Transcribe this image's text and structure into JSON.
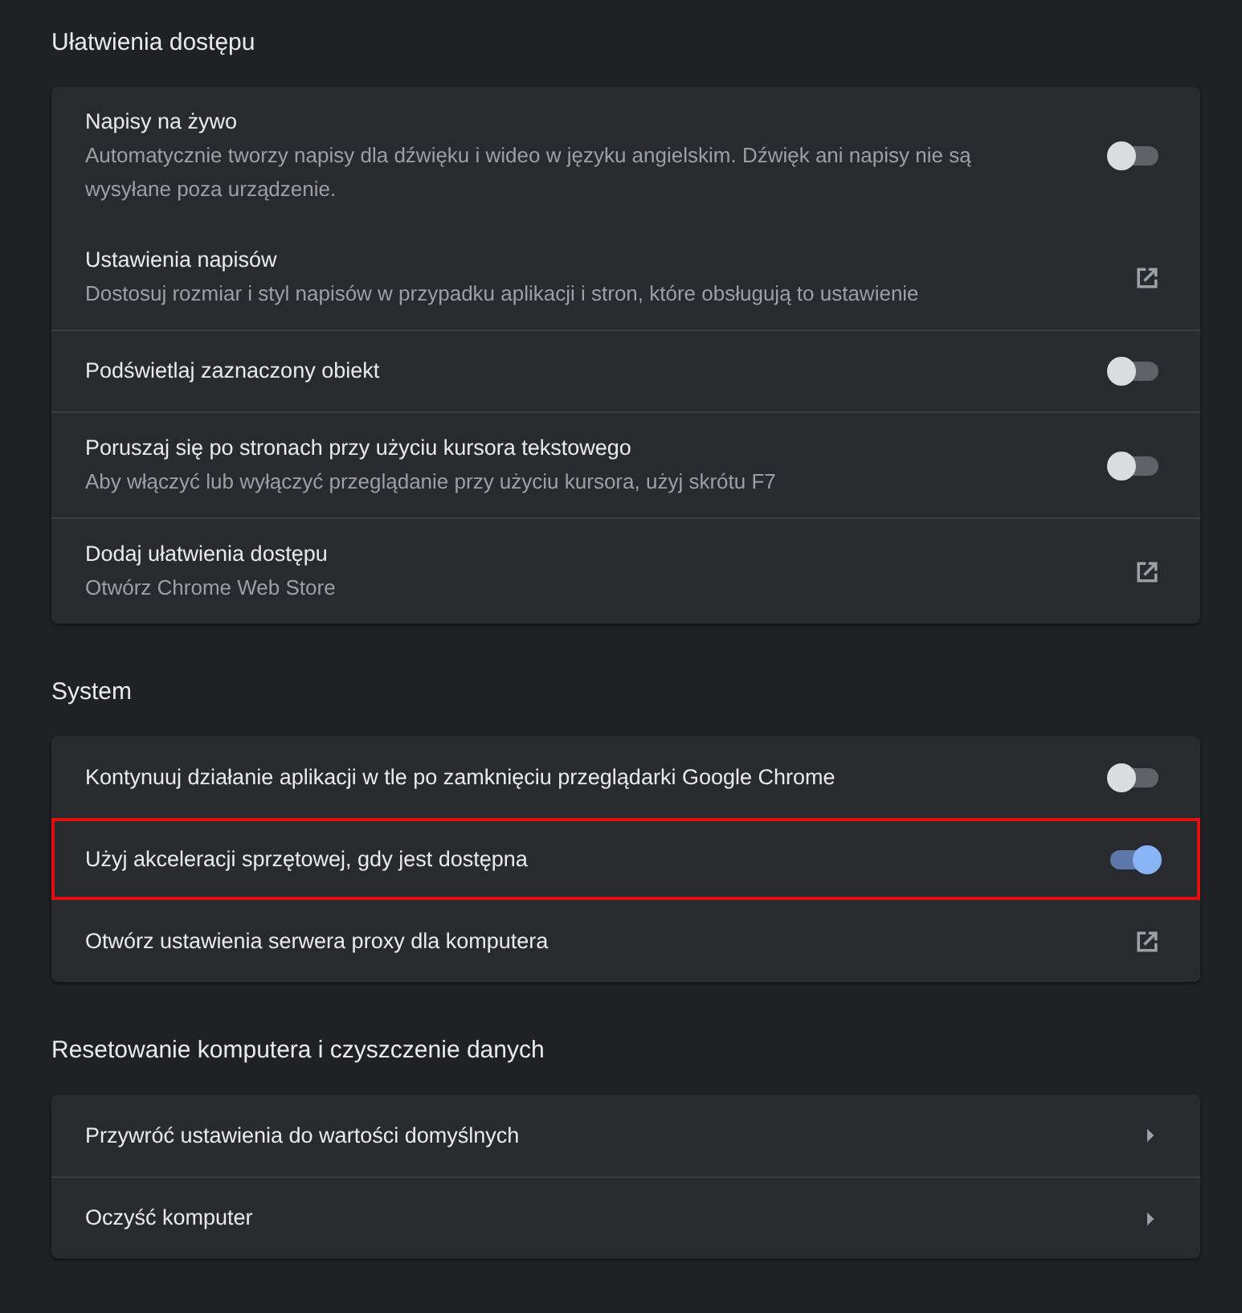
{
  "sections": [
    {
      "title": "Ułatwienia dostępu",
      "rows": [
        {
          "kind": "toggle",
          "label": "Napisy na żywo",
          "sublabel": "Automatycznie tworzy napisy dla dźwięku i wideo w języku angielskim. Dźwięk ani napisy nie są wysyłane poza urządzenie.",
          "on": false,
          "divider": false,
          "highlighted": false
        },
        {
          "kind": "external",
          "label": "Ustawienia napisów",
          "sublabel": "Dostosuj rozmiar i styl napisów w przypadku aplikacji i stron, które obsługują to ustawienie",
          "divider": false,
          "highlighted": false
        },
        {
          "kind": "toggle",
          "label": "Podświetlaj zaznaczony obiekt",
          "on": false,
          "divider": true,
          "highlighted": false
        },
        {
          "kind": "toggle",
          "label": "Poruszaj się po stronach przy użyciu kursora tekstowego",
          "sublabel": "Aby włączyć lub wyłączyć przeglądanie przy użyciu kursora, użyj skrótu F7",
          "on": false,
          "divider": true,
          "highlighted": false
        },
        {
          "kind": "external",
          "label": "Dodaj ułatwienia dostępu",
          "sublabel": "Otwórz Chrome Web Store",
          "divider": true,
          "highlighted": false
        }
      ]
    },
    {
      "title": "System",
      "rows": [
        {
          "kind": "toggle",
          "label": "Kontynuuj działanie aplikacji w tle po zamknięciu przeglądarki Google Chrome",
          "on": false,
          "divider": false,
          "highlighted": false
        },
        {
          "kind": "toggle",
          "label": "Użyj akceleracji sprzętowej, gdy jest dostępna",
          "on": true,
          "divider": false,
          "highlighted": true
        },
        {
          "kind": "external",
          "label": "Otwórz ustawienia serwera proxy dla komputera",
          "divider": false,
          "highlighted": false
        }
      ]
    },
    {
      "title": "Resetowanie komputera i czyszczenie danych",
      "rows": [
        {
          "kind": "arrow",
          "label": "Przywróć ustawienia do wartości domyślnych",
          "divider": false,
          "highlighted": false
        },
        {
          "kind": "arrow",
          "label": "Oczyść komputer",
          "divider": true,
          "highlighted": false
        }
      ]
    }
  ]
}
